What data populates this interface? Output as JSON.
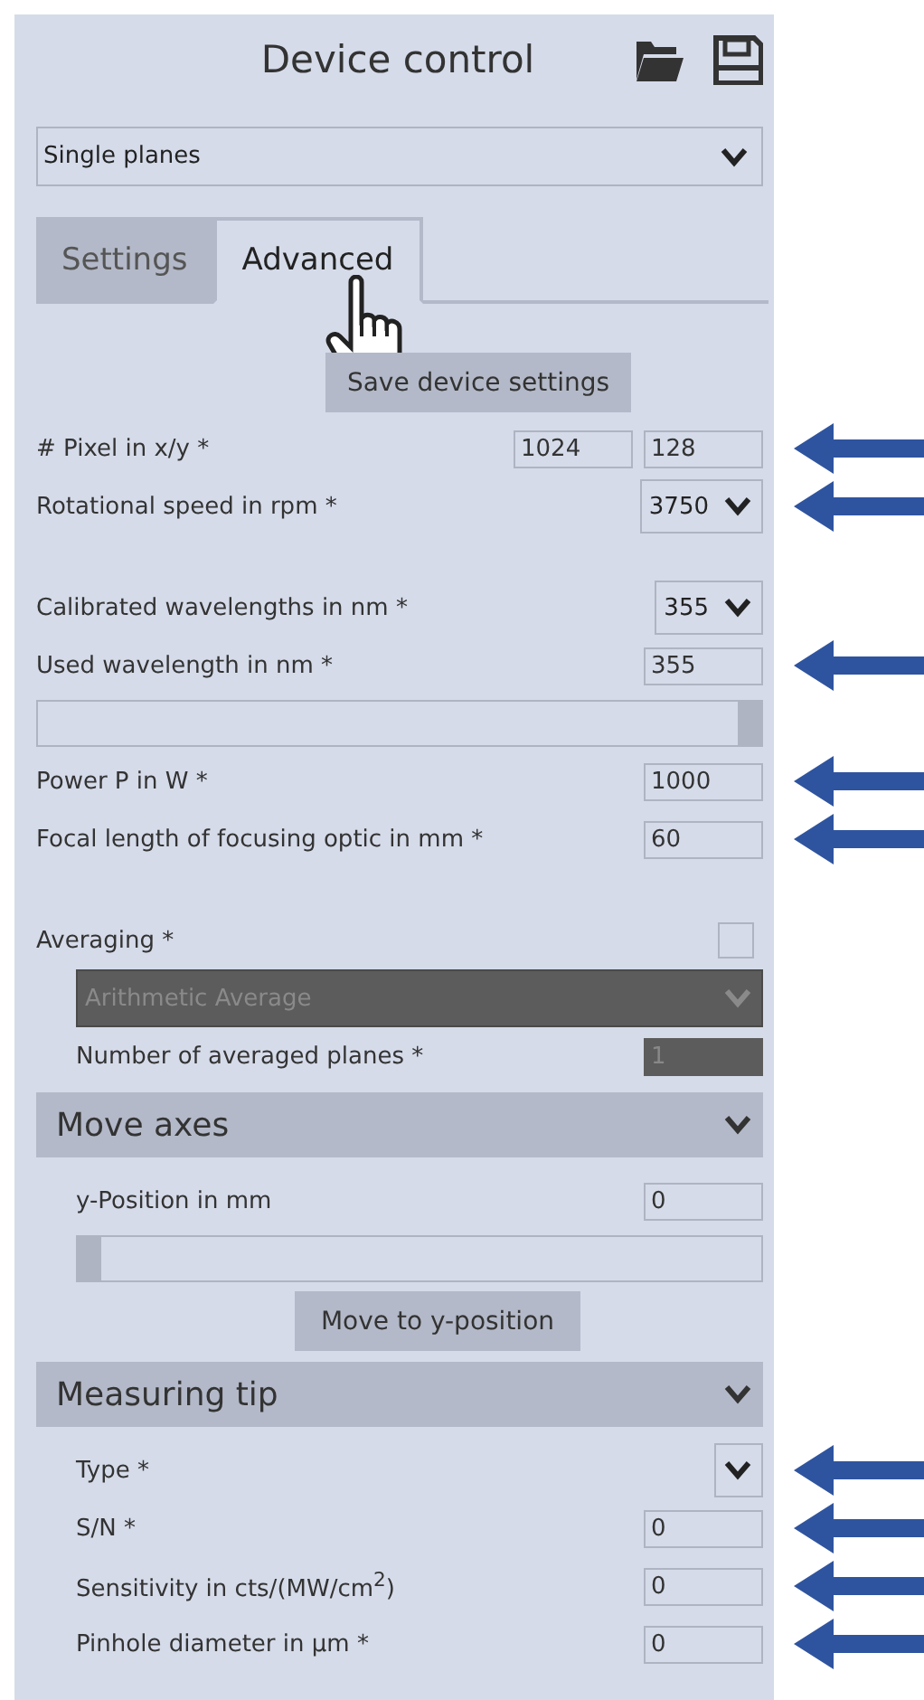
{
  "header": {
    "title": "Device control"
  },
  "mode_select": {
    "value": "Single planes"
  },
  "tabs": [
    {
      "label": "Settings",
      "selected": false
    },
    {
      "label": "Advanced",
      "selected": true
    }
  ],
  "save_button": {
    "label": "Save device settings"
  },
  "sections": [
    {
      "kind": "plain",
      "groups": [
        {
          "rows": [
            {
              "kind": "pair",
              "label": "# Pixel in x/y *",
              "values": [
                "1024",
                "128"
              ],
              "annotated": true
            },
            {
              "kind": "select",
              "label": "Rotational speed in rpm *",
              "value": "3750",
              "annotated": true
            }
          ]
        },
        {
          "rows": [
            {
              "kind": "select",
              "label": "Calibrated wavelengths in nm *",
              "value": "355",
              "annotated": false
            },
            {
              "kind": "field",
              "label": "Used wavelength in nm *",
              "value": "355",
              "annotated": true
            },
            {
              "kind": "slider",
              "level": 1
            },
            {
              "kind": "field",
              "label": "Power P in W *",
              "value": "1000",
              "annotated": true
            },
            {
              "kind": "field",
              "label": "Focal length of focusing optic in mm *",
              "value": "60",
              "annotated": true
            }
          ]
        },
        {
          "rows": [
            {
              "kind": "checkbox",
              "label": "Averaging *",
              "checked": false,
              "children": [
                {
                  "kind": "select",
                  "value": "Arithmetic Average",
                  "disabled": true
                },
                {
                  "kind": "field",
                  "label": "Number of averaged planes *",
                  "value": "1",
                  "disabled": true
                }
              ]
            }
          ]
        }
      ]
    },
    {
      "kind": "collapsible",
      "title": "Move axes",
      "expanded": true,
      "groups": [
        {
          "rows": [
            {
              "kind": "field",
              "label": "y-Position in mm",
              "value": "0",
              "annotated": false
            },
            {
              "kind": "slider",
              "level": 0
            },
            {
              "kind": "button",
              "label": "Move to y-position"
            }
          ]
        }
      ]
    },
    {
      "kind": "collapsible",
      "title": "Measuring tip",
      "expanded": true,
      "groups": [
        {
          "rows": [
            {
              "kind": "select",
              "label": "Type *",
              "annotated": true
            },
            {
              "kind": "field",
              "label": "S/N *",
              "value": "0",
              "annotated": true
            },
            {
              "kind": "field",
              "label": "Sensitivity in cts/(MW/cm$^{2}$)",
              "value": "0",
              "annotated": true
            },
            {
              "kind": "field",
              "label": "Pinhole diameter in µm *",
              "value": "0",
              "annotated": true
            }
          ]
        }
      ]
    }
  ]
}
